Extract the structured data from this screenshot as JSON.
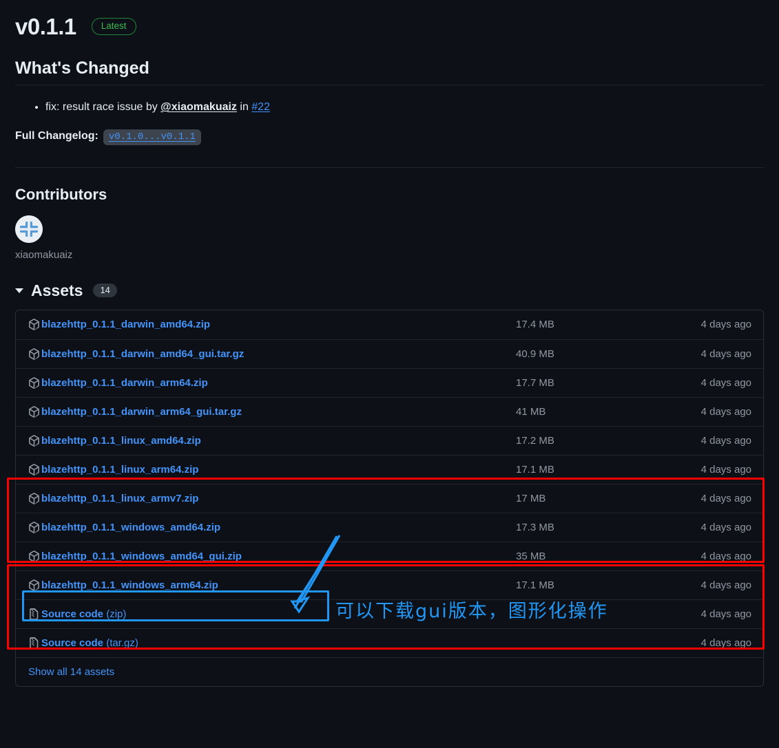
{
  "release": {
    "tag": "v0.1.1",
    "latest_badge": "Latest",
    "whats_changed_title": "What's Changed",
    "change_items": [
      {
        "prefix": "fix: result race issue by ",
        "author": "@xiaomakuaiz",
        "middle": " in ",
        "pr": "#22"
      }
    ],
    "full_changelog_label": "Full Changelog:",
    "full_changelog_value": "v0.1.0...v0.1.1"
  },
  "contributors": {
    "title": "Contributors",
    "people": [
      {
        "name": "xiaomakuaiz"
      }
    ]
  },
  "assets": {
    "title": "Assets",
    "count": "14",
    "show_all_label": "Show all 14 assets",
    "rows": [
      {
        "name": "blazehttp_0.1.1_darwin_amd64.zip",
        "suffix": "",
        "size": "17.4 MB",
        "date": "4 days ago",
        "icon": "package-icon"
      },
      {
        "name": "blazehttp_0.1.1_darwin_amd64_gui.tar.gz",
        "suffix": "",
        "size": "40.9 MB",
        "date": "4 days ago",
        "icon": "package-icon"
      },
      {
        "name": "blazehttp_0.1.1_darwin_arm64.zip",
        "suffix": "",
        "size": "17.7 MB",
        "date": "4 days ago",
        "icon": "package-icon"
      },
      {
        "name": "blazehttp_0.1.1_darwin_arm64_gui.tar.gz",
        "suffix": "",
        "size": "41 MB",
        "date": "4 days ago",
        "icon": "package-icon"
      },
      {
        "name": "blazehttp_0.1.1_linux_amd64.zip",
        "suffix": "",
        "size": "17.2 MB",
        "date": "4 days ago",
        "icon": "package-icon"
      },
      {
        "name": "blazehttp_0.1.1_linux_arm64.zip",
        "suffix": "",
        "size": "17.1 MB",
        "date": "4 days ago",
        "icon": "package-icon"
      },
      {
        "name": "blazehttp_0.1.1_linux_armv7.zip",
        "suffix": "",
        "size": "17 MB",
        "date": "4 days ago",
        "icon": "package-icon"
      },
      {
        "name": "blazehttp_0.1.1_windows_amd64.zip",
        "suffix": "",
        "size": "17.3 MB",
        "date": "4 days ago",
        "icon": "package-icon"
      },
      {
        "name": "blazehttp_0.1.1_windows_amd64_gui.zip",
        "suffix": "",
        "size": "35 MB",
        "date": "4 days ago",
        "icon": "package-icon"
      },
      {
        "name": "blazehttp_0.1.1_windows_arm64.zip",
        "suffix": "",
        "size": "17.1 MB",
        "date": "4 days ago",
        "icon": "package-icon"
      },
      {
        "name": "Source code",
        "suffix": " (zip)",
        "size": "",
        "date": "4 days ago",
        "icon": "file-zip-icon"
      },
      {
        "name": "Source code",
        "suffix": " (tar.gz)",
        "size": "",
        "date": "4 days ago",
        "icon": "file-zip-icon"
      }
    ]
  },
  "annotations": {
    "chinese_note": "可以下载gui版本，图形化操作",
    "red_color": "#fe0000",
    "blue_color": "#2196f3"
  }
}
